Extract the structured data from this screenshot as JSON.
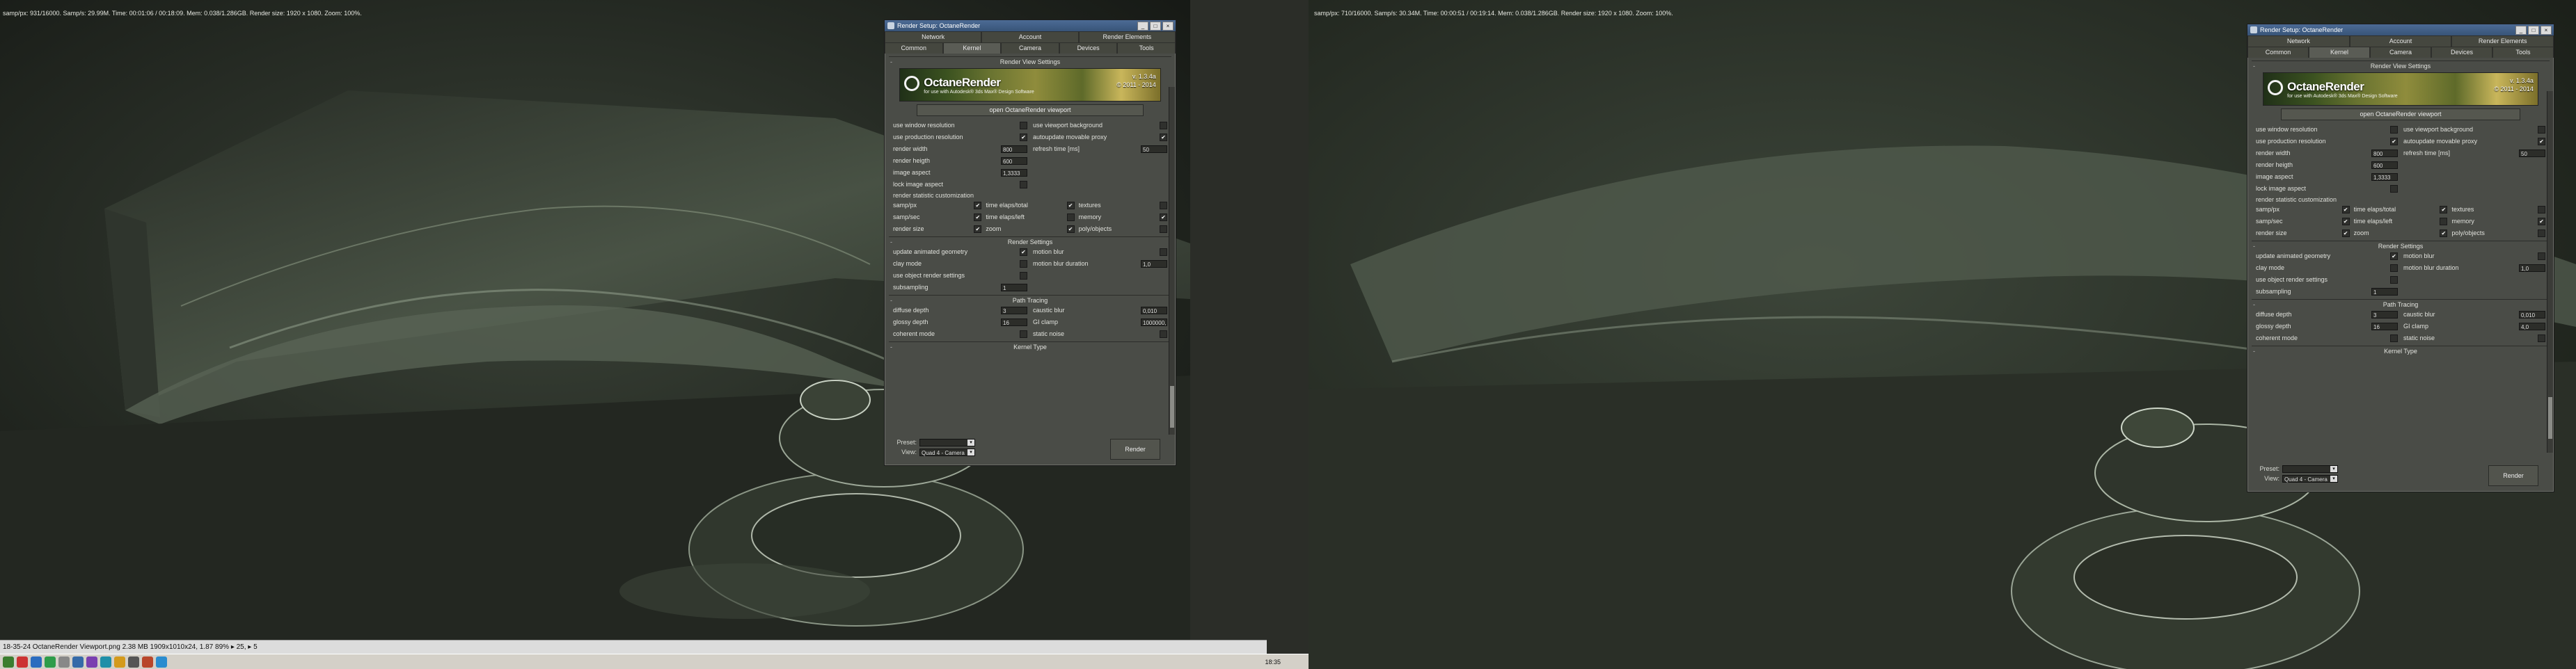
{
  "left_viewport": {
    "stats": "samp/px: 931/16000.   Samp/s: 29.99M.   Time: 00:01:06 / 00:18:09.   Mem: 0.038/1.286GB.   Render size: 1920 x 1080.   Zoom: 100%."
  },
  "right_viewport": {
    "stats": "samp/px: 710/16000.   Samp/s: 30.34M.   Time: 00:00:51 / 00:19:14.   Mem: 0.038/1.286GB.   Render size: 1920 x 1080.   Zoom: 100%."
  },
  "dialog": {
    "title": "Render Setup: OctaneRender",
    "tabs_top": [
      "Network",
      "Account",
      "Render Elements"
    ],
    "tabs_bottom": [
      "Common",
      "Kernel",
      "Camera",
      "Devices",
      "Tools"
    ],
    "active_tab": "Kernel",
    "sections": {
      "render_view": "Render View Settings",
      "render": "Render Settings",
      "path": "Path Tracing",
      "kernel": "Kernel Type"
    },
    "banner": {
      "name": "OctaneRender",
      "tagline": "for use with Autodesk® 3ds Max® Design Software",
      "version": "v. 1.3.4a",
      "years": "© 2011 - 2014"
    },
    "open_viewport_button": "open OctaneRender viewport",
    "view_settings": {
      "use_window_resolution": "use window resolution",
      "use_viewport_background": "use viewport background",
      "use_production_resolution": "use production resolution",
      "autoupdate_proxy": "autoupdate movable proxy",
      "render_width": "render width",
      "render_width_val": "800",
      "refresh_time": "refresh time [ms]",
      "refresh_time_val": "50",
      "render_height": "render heigth",
      "render_height_val": "600",
      "image_aspect": "image aspect",
      "image_aspect_val": "1,3333",
      "lock_aspect": "lock image aspect"
    },
    "stat_customization_label": "render statistic customization",
    "stats": {
      "samp_px": "samp/px",
      "time_elapsed_total": "time elaps/total",
      "textures": "textures",
      "samp_sec": "samp/sec",
      "time_elapsed_left": "time elaps/left",
      "memory": "memory",
      "render_size": "render size",
      "zoom": "zoom",
      "polyobjects": "poly/objects"
    },
    "render_settings": {
      "update_geometry": "update animated geometry",
      "motion_blur": "motion blur",
      "clay_mode": "clay mode",
      "motion_blur_duration": "motion blur duration",
      "motion_blur_duration_val": "1,0",
      "use_object_render": "use object render settings",
      "subsampling": "subsampling",
      "subsampling_val": "1"
    },
    "path_tracing": {
      "diffuse_depth": "diffuse depth",
      "diffuse_depth_val": "3",
      "caustic_blur": "caustic blur",
      "caustic_blur_val": "0,010",
      "glossy_depth": "glossy depth",
      "glossy_depth_val": "16",
      "gi_clamp": "GI clamp",
      "gi_clamp_left_val": "1000000,",
      "gi_clamp_right_val": "4,0",
      "coherent_mode": "coherent mode",
      "static_noise": "static noise"
    },
    "preset_label": "Preset:",
    "view_label": "View:",
    "view_value": "Quad 4 - Camera",
    "render_button": "Render"
  },
  "info_bar": "18-35-24 OctaneRender Viewport.png   2.38 MB    1909x1010x24, 1.87    89%   ▸ 25, ▸ 5",
  "tray_time": "18:35",
  "colors": {
    "scene_dark": "#1b1f19",
    "scene_light": "#4a5447",
    "dialog_bg": "#4a4c47",
    "title_blue": "#385478"
  }
}
